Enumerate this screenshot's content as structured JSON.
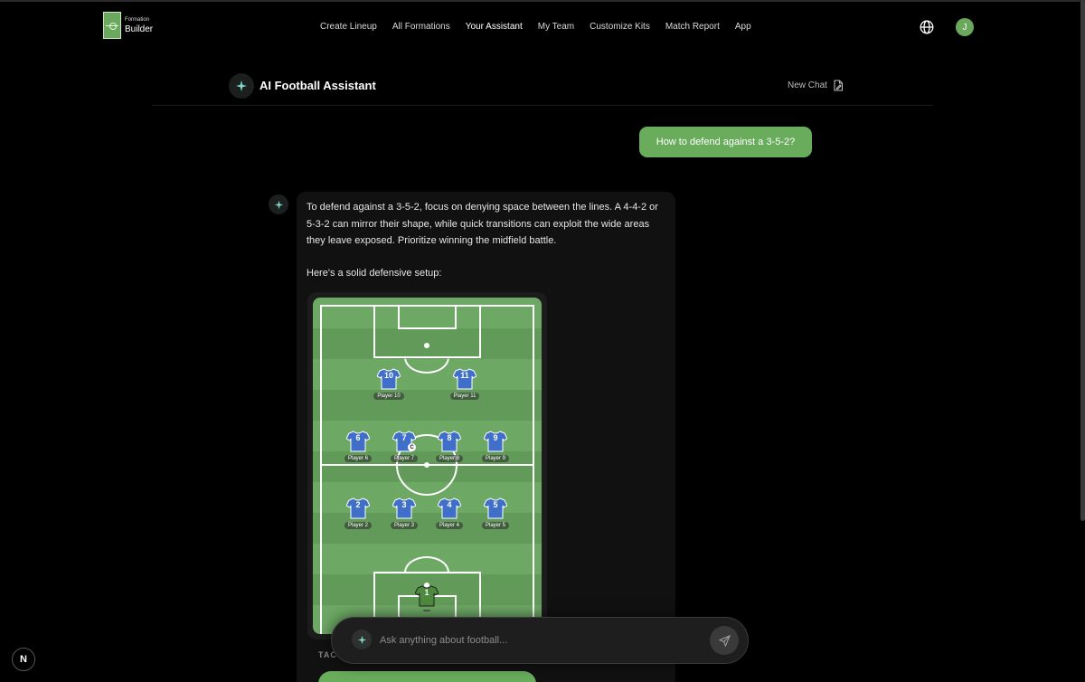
{
  "header": {
    "logo_small": "Formation",
    "logo_big": "Builder",
    "nav": [
      {
        "label": "Create Lineup"
      },
      {
        "label": "All Formations"
      },
      {
        "label": "Your Assistant"
      },
      {
        "label": "My Team"
      },
      {
        "label": "Customize Kits"
      },
      {
        "label": "Match Report"
      },
      {
        "label": "App"
      }
    ],
    "active_nav": "Your Assistant",
    "avatar_initial": "J"
  },
  "assistant": {
    "title": "AI Football Assistant",
    "new_chat_label": "New Chat"
  },
  "conversation": {
    "user_message": "How to defend against a 3-5-2?",
    "bot_paragraph_1": "To defend against a 3-5-2, focus on denying space between the lines. A 4-4-2 or 5-3-2 can mirror their shape, while quick transitions can exploit the wide areas they leave exposed. Prioritize winning the midfield battle.",
    "bot_paragraph_2": "Here's a solid defensive setup:",
    "tactic_label_partial": "TAC"
  },
  "lineup": {
    "formation": "4-4-2",
    "players": [
      {
        "number": "10",
        "name": "Player 10",
        "role": "forward"
      },
      {
        "number": "11",
        "name": "Player 11",
        "role": "forward"
      },
      {
        "number": "6",
        "name": "Player 6",
        "role": "midfielder"
      },
      {
        "number": "7",
        "name": "Player 7",
        "role": "midfielder",
        "captain": true
      },
      {
        "number": "8",
        "name": "Player 8",
        "role": "midfielder"
      },
      {
        "number": "9",
        "name": "Player 9",
        "role": "midfielder"
      },
      {
        "number": "2",
        "name": "Player 2",
        "role": "defender"
      },
      {
        "number": "3",
        "name": "Player 3",
        "role": "defender"
      },
      {
        "number": "4",
        "name": "Player 4",
        "role": "defender"
      },
      {
        "number": "5",
        "name": "Player 5",
        "role": "defender"
      },
      {
        "number": "1",
        "name": "",
        "role": "goalkeeper"
      }
    ],
    "captain_mark": "C",
    "outfield_kit_color": "#3f6fc9",
    "goalkeeper_kit_color": "#4e8a3e",
    "pitch_color": "#6ea865"
  },
  "input": {
    "placeholder": "Ask anything about football..."
  },
  "colors": {
    "accent_green": "#68ac5c",
    "background": "#000000"
  },
  "badge": {
    "label": "N"
  }
}
